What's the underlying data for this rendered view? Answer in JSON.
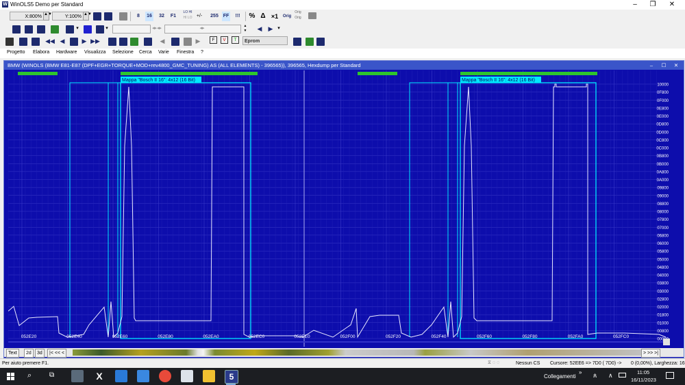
{
  "window": {
    "title": "WinOLS5 Demo per Standard",
    "controls": [
      "–",
      "❐",
      "✕"
    ]
  },
  "toolbar1": {
    "zoom_x": "X:800%",
    "zoom_y": "Y:100%",
    "btn_8": "8",
    "btn_16": "16",
    "btn_32": "32",
    "btn_f1": "F1",
    "btn_lohi": "LO HI",
    "btn_hilo": "HI LO",
    "btn_255": "255",
    "btn_ff": "FF",
    "percent": "%",
    "delta": "Δ",
    "x1": "×1",
    "orig1": "Orig",
    "orig2": "Orig"
  },
  "toolbar3": {
    "eprom_label": "Eprom"
  },
  "menu": [
    "Progetto",
    "Elabora",
    "Hardware",
    "Visualizza",
    "Selezione",
    "Cerca",
    "Varie",
    "Finestra",
    "?"
  ],
  "child": {
    "title": "BMW (WINOLS (BMW E81-E87 (DPF+EGR+TORQUE+MOD+rev4800_GMC_TUNING) AS (ALL ELEMENTS) - 396565)), 396565, Hexdump per Standard",
    "controls": [
      "–",
      "☐",
      "✕"
    ]
  },
  "graph": {
    "map_label_1": "Mappa \"Bosch II 16\": 4x12 (16 Bit)",
    "map_label_2": "Mappa \"Bosch II 16\": 4x12 (16 Bit)",
    "y_ticks": [
      "10000",
      "0F800",
      "0F000",
      "0E800",
      "0E000",
      "0D800",
      "0D000",
      "0C800",
      "0C000",
      "0B800",
      "0B000",
      "0A800",
      "0A000",
      "09800",
      "09000",
      "08800",
      "08000",
      "07800",
      "07000",
      "06800",
      "06000",
      "05800",
      "05000",
      "04800",
      "04000",
      "03800",
      "03000",
      "02800",
      "02000",
      "01800",
      "01000",
      "00800",
      "00000"
    ],
    "x_ticks": [
      "052E20",
      "052E40",
      "052E60",
      "052E80",
      "052EA0",
      "052EC0",
      "052EE0",
      "052F00",
      "052F20",
      "052F40",
      "052F60",
      "052F80",
      "052FA0",
      "052FC0"
    ],
    "colors": {
      "background": "#0d0dac",
      "grid": "#4a4ad0",
      "trace": "#e8e8ff",
      "map_frame": "#00e8ff",
      "map_bar": "#2ec42e"
    }
  },
  "tabs": {
    "text": "Text",
    "t2d": "2d",
    "t3d": "3d",
    "nav": "|< << <",
    "nav_end": "> >> >|"
  },
  "status": {
    "help": "Per aiuto premere F1.",
    "cs": "Nessun CS",
    "cursor": "Cursore: 52EE6 => 7D0 ( 7D0) ->",
    "extra": "0 (0,00%), Larghezza: 16"
  },
  "taskbar": {
    "links": "Collegamenti",
    "chevron": "»",
    "time": "11:05",
    "date": "16/11/2023"
  }
}
